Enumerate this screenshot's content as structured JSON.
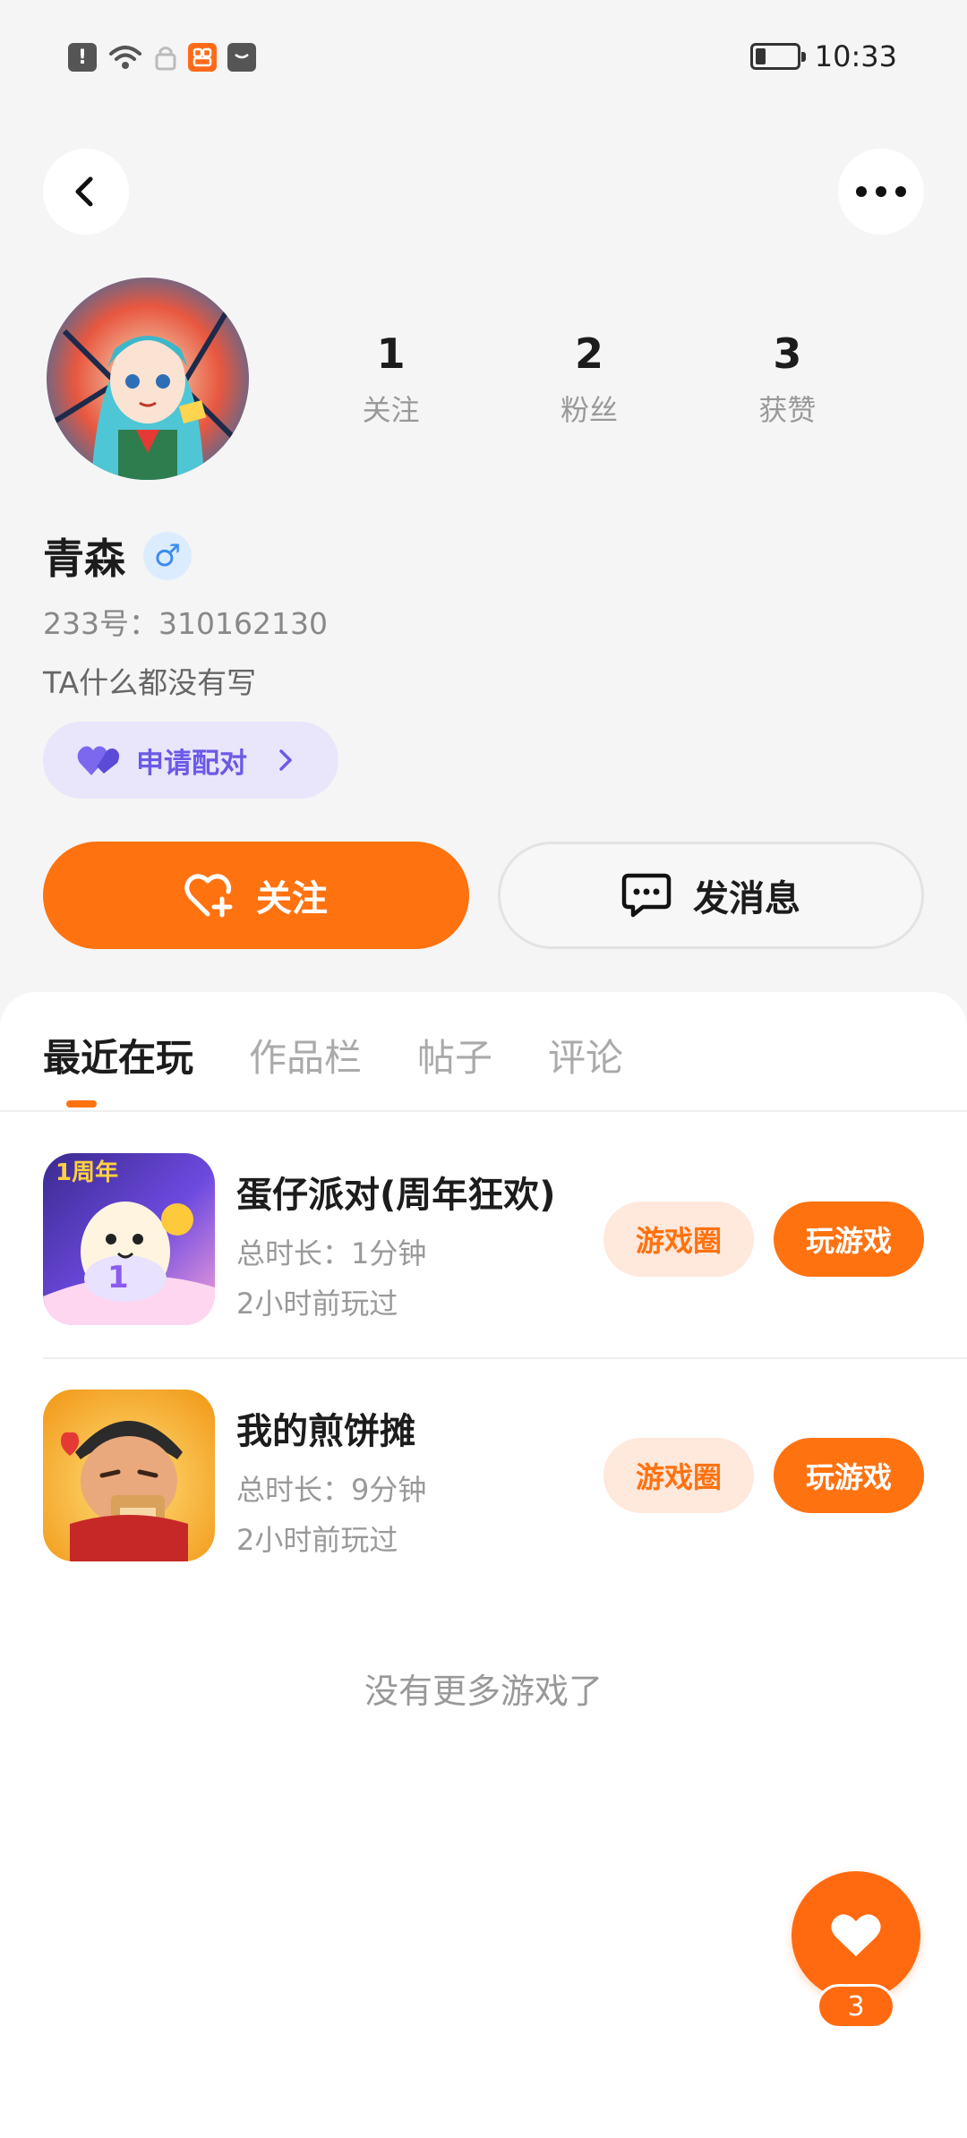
{
  "status_bar": {
    "app_badge": "",
    "time": "10:33",
    "battery_level": 0.25
  },
  "profile": {
    "name": "青森",
    "gender_symbol": "♂",
    "id_text": "233号：310162130",
    "bio": "TA什么都没有写",
    "stats": [
      {
        "value": "1",
        "label": "关注"
      },
      {
        "value": "2",
        "label": "粉丝"
      },
      {
        "value": "3",
        "label": "获赞"
      }
    ]
  },
  "actions": {
    "pair_label": "申请配对",
    "follow_label": "关注",
    "message_label": "发消息"
  },
  "tabs": [
    {
      "label": "最近在玩",
      "active": true
    },
    {
      "label": "作品栏",
      "active": false
    },
    {
      "label": "帖子",
      "active": false
    },
    {
      "label": "评论",
      "active": false
    }
  ],
  "games": [
    {
      "name": "蛋仔派对(周年狂欢)",
      "icon_badge": "1周年",
      "duration": "总时长：1分钟",
      "last_played": "2小时前玩过",
      "circle_label": "游戏圈",
      "play_label": "玩游戏"
    },
    {
      "name": "我的煎饼摊",
      "duration": "总时长：9分钟",
      "last_played": "2小时前玩过",
      "circle_label": "游戏圈",
      "play_label": "玩游戏"
    }
  ],
  "footer": {
    "no_more": "没有更多游戏了"
  },
  "fab": {
    "count": "3"
  },
  "colors": {
    "accent": "#ff7210",
    "pair_bg": "#e9e5fb",
    "pair_text": "#6b5ae6",
    "gender": "#3a8df0"
  },
  "icons": [
    "back-icon",
    "more-icon",
    "heart-plus-icon",
    "chat-icon",
    "heart-icon",
    "chevron-right-icon",
    "wifi-icon",
    "battery-icon"
  ]
}
